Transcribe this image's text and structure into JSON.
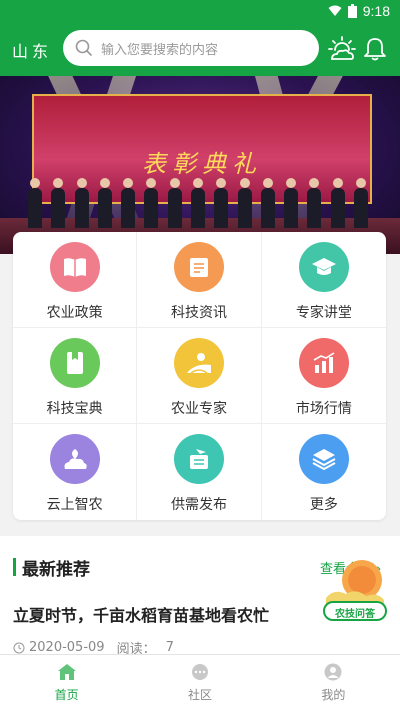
{
  "status_bar": {
    "time": "9:18"
  },
  "header": {
    "region": "山东",
    "search_placeholder": "输入您要搜索的内容"
  },
  "banner": {
    "headline": "表彰典礼"
  },
  "grid": [
    {
      "label": "农业政策",
      "icon": "book-icon",
      "color": "#f07d8c"
    },
    {
      "label": "科技资讯",
      "icon": "news-icon",
      "color": "#f59a52"
    },
    {
      "label": "专家讲堂",
      "icon": "graduation-cap-icon",
      "color": "#43c6a8"
    },
    {
      "label": "科技宝典",
      "icon": "bookmark-book-icon",
      "color": "#69c95a"
    },
    {
      "label": "农业专家",
      "icon": "field-icon",
      "color": "#f2c43a"
    },
    {
      "label": "市场行情",
      "icon": "bar-chart-icon",
      "color": "#f06a6a"
    },
    {
      "label": "云上智农",
      "icon": "cloud-leaf-icon",
      "color": "#9b83e0"
    },
    {
      "label": "供需发布",
      "icon": "send-doc-icon",
      "color": "#3ec6b2"
    },
    {
      "label": "更多",
      "icon": "layers-icon",
      "color": "#4c9ff0"
    }
  ],
  "recommend": {
    "section_title": "最新推荐",
    "more_label": "查看全部",
    "article_title": "立夏时节，千亩水稻育苗基地看农忙",
    "date": "2020-05-09",
    "read_label": "阅读：",
    "read_count": "7",
    "badge_label": "农技问答"
  },
  "tabs": [
    {
      "label": "首页",
      "icon": "home-icon",
      "active": true
    },
    {
      "label": "社区",
      "icon": "chat-icon",
      "active": false
    },
    {
      "label": "我的",
      "icon": "user-icon",
      "active": false
    }
  ],
  "colors": {
    "primary": "#17a444"
  }
}
